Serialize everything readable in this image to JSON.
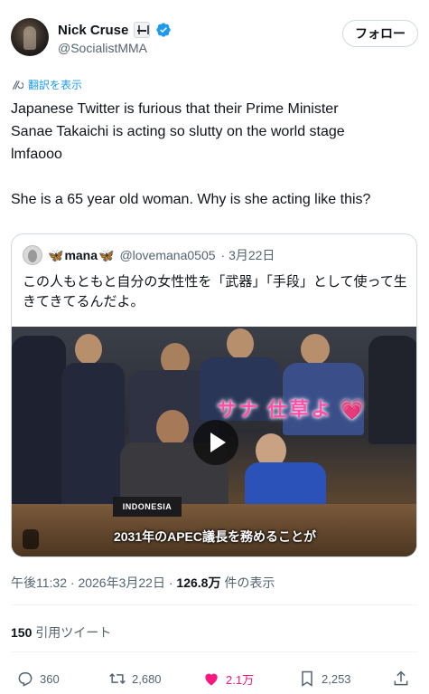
{
  "author": {
    "name": "Nick Cruse",
    "handle": "@SocialistMMA",
    "badge_icon": "kimono-icon",
    "verified_icon": "verified-badge-icon",
    "follow_label": "フォロー"
  },
  "translate_label": "翻訳を表示",
  "post": {
    "line1": "Japanese Twitter is furious that their Prime Minister",
    "line2": "Sanae Takaichi is acting so slutty on the world stage",
    "line3": "lmfaooo",
    "line4": "She is a 65 year old woman. Why is she acting like this?"
  },
  "quote": {
    "name": "mana",
    "name_prefix": "🦋",
    "name_suffix": "🦋",
    "handle": "@lovemana0505",
    "date": "· 3月22日",
    "text": "この人もともと自分の女性性を「武器」「手段」として使って生きてきてるんだよ。",
    "video": {
      "overlay_text": "サナ 仕草よ 💗",
      "nameplate": "INDONESIA",
      "subtitle": "2031年のAPEC議長を務めることが"
    }
  },
  "meta": {
    "time": "午後11:32",
    "sep1": " · ",
    "date": "2026年3月22日",
    "sep2": " · ",
    "views": "126.8万",
    "views_suffix": " 件の表示"
  },
  "quotes": {
    "count": "150",
    "label": "引用ツイート"
  },
  "actions": {
    "replies": "360",
    "retweets": "2,680",
    "likes": "2.1万",
    "bookmarks": "2,253"
  },
  "colors": {
    "accent": "#1d9bf0",
    "like": "#f91880",
    "text": "#0f1419",
    "secondary": "#536471"
  }
}
